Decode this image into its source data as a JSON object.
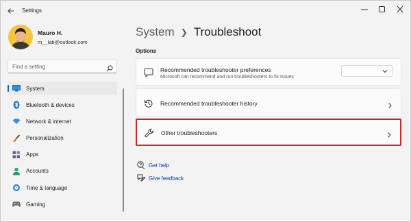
{
  "window": {
    "title": "Settings"
  },
  "user": {
    "name": "Mauro H.",
    "email": "m__lab@outlook.com"
  },
  "search": {
    "placeholder": "Find a setting"
  },
  "nav": [
    {
      "label": "System",
      "icon": "monitor-icon",
      "active": true
    },
    {
      "label": "Bluetooth & devices",
      "icon": "bluetooth-icon"
    },
    {
      "label": "Network & internet",
      "icon": "wifi-icon"
    },
    {
      "label": "Personalization",
      "icon": "brush-icon"
    },
    {
      "label": "Apps",
      "icon": "apps-icon"
    },
    {
      "label": "Accounts",
      "icon": "person-icon"
    },
    {
      "label": "Time & language",
      "icon": "globe-clock-icon"
    },
    {
      "label": "Gaming",
      "icon": "gamepad-icon"
    }
  ],
  "main": {
    "breadcrumb_parent": "System",
    "breadcrumb_current": "Troubleshoot",
    "section": "Options",
    "cards": [
      {
        "title": "Recommended troubleshooter preferences",
        "description": "Microsoft can recommend and run troubleshooters to fix issues",
        "icon": "chat-bubble-icon",
        "control": "dropdown",
        "value": ""
      },
      {
        "title": "Recommended troubleshooter history",
        "icon": "history-icon",
        "control": "chevron"
      },
      {
        "title": "Other troubleshooters",
        "icon": "wrench-icon",
        "control": "chevron",
        "highlighted": true
      }
    ],
    "links": [
      {
        "label": "Get help",
        "icon": "help-icon"
      },
      {
        "label": "Give feedback",
        "icon": "feedback-icon"
      }
    ]
  },
  "colors": {
    "accent": "#0067c0",
    "highlight_border": "#c62828",
    "link": "#003e92"
  }
}
